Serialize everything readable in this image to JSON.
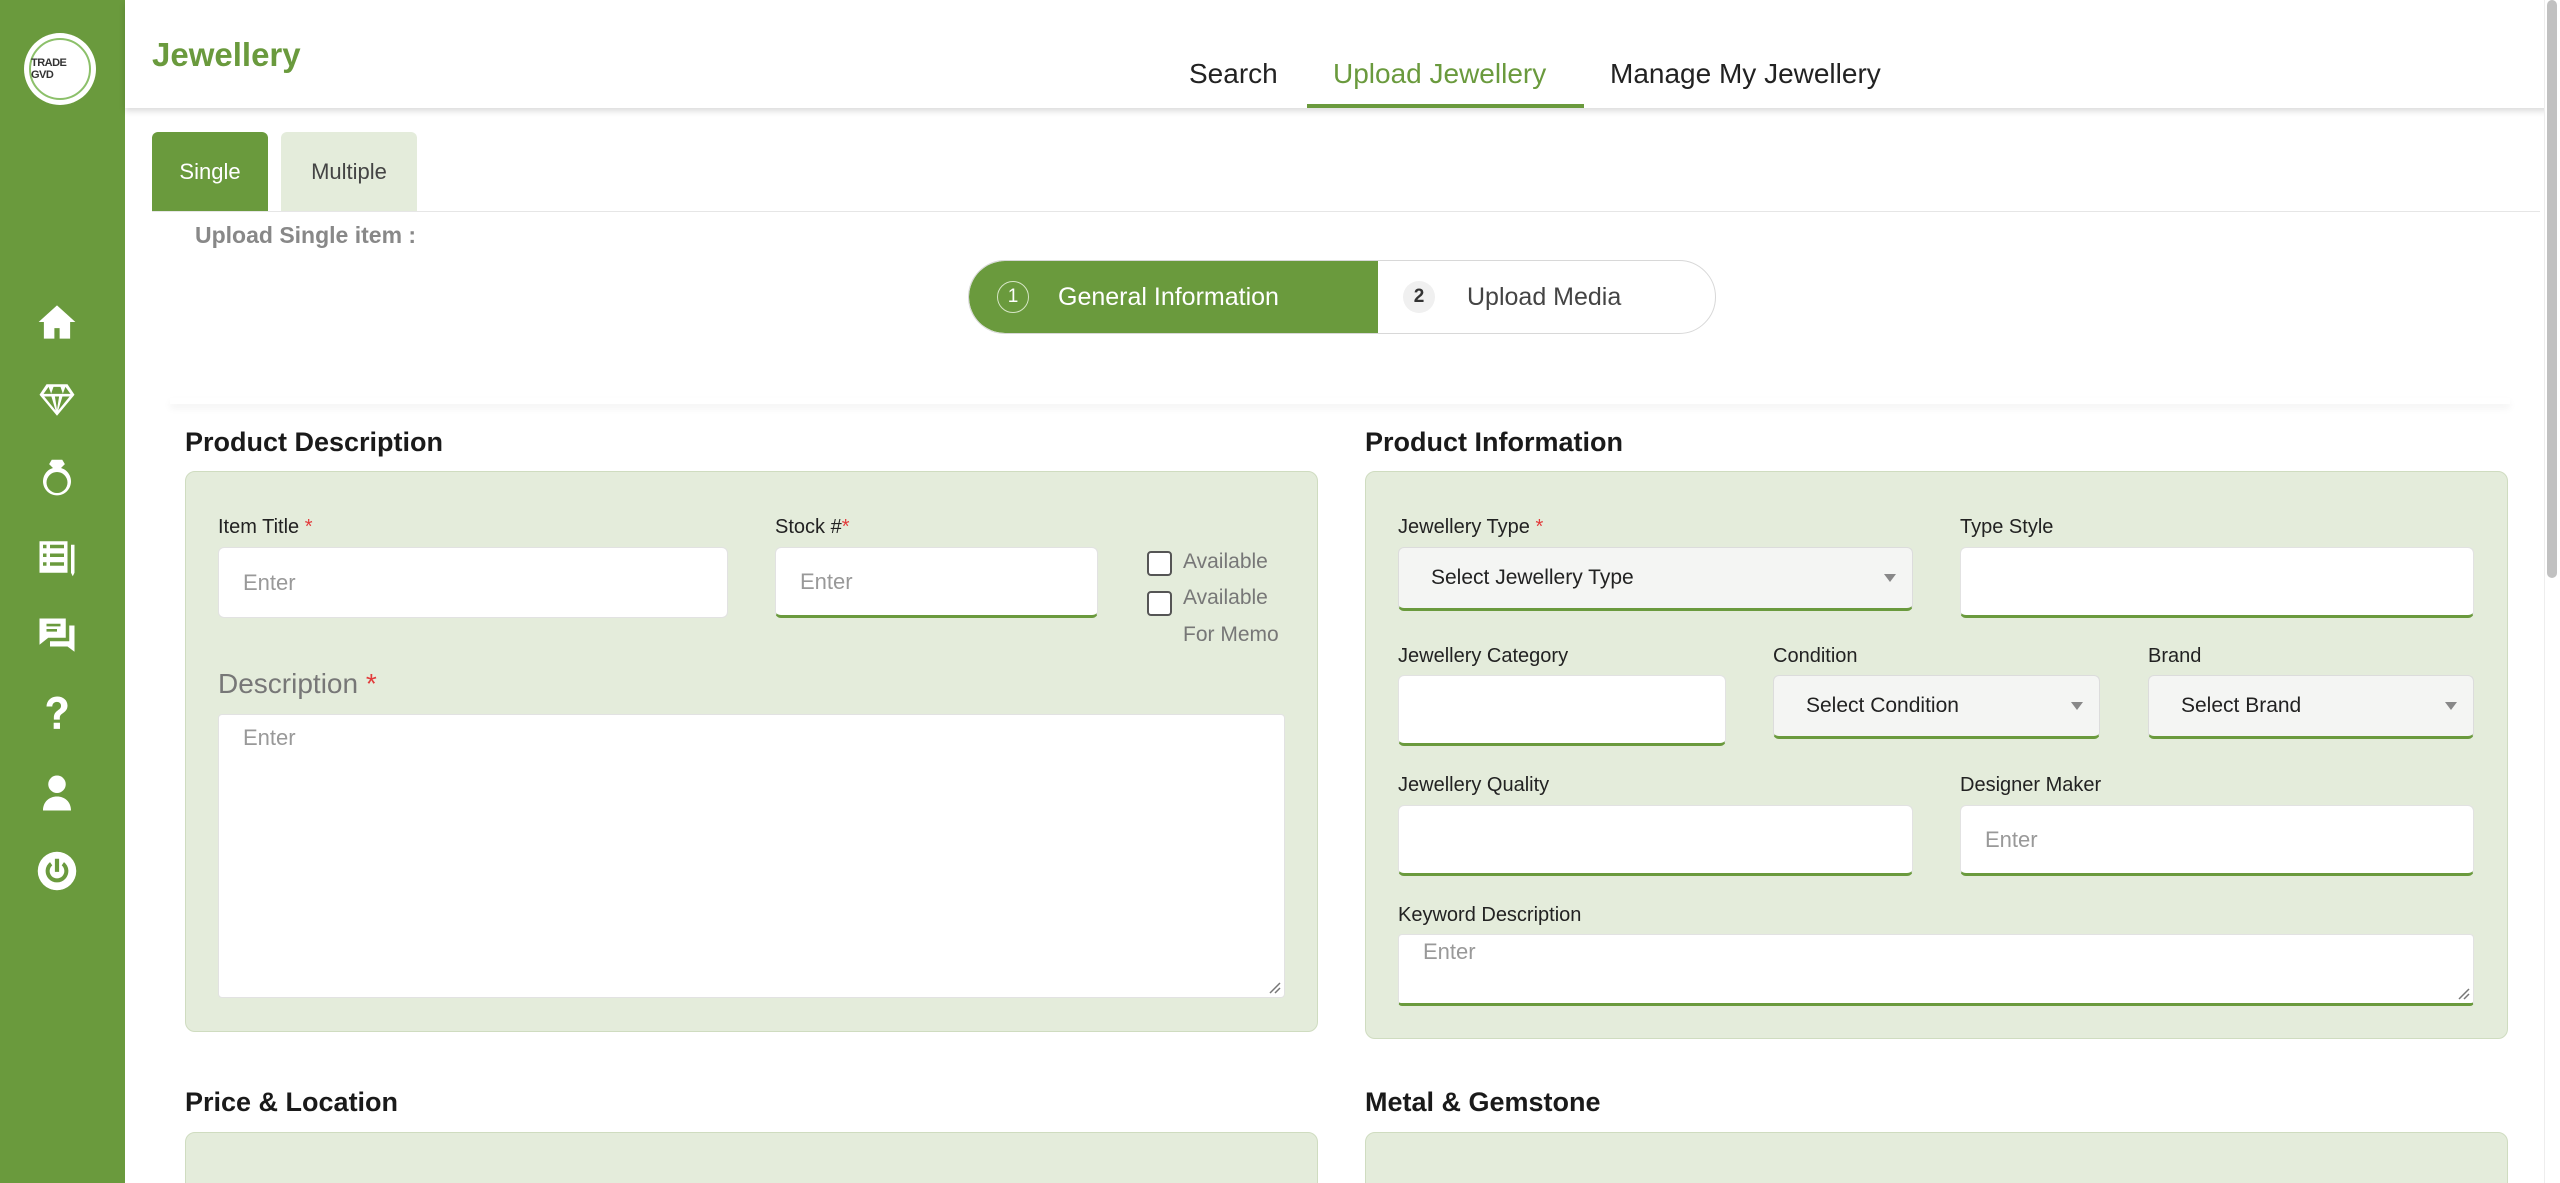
{
  "app": {
    "logo_text": "TRADE GVD",
    "page_title": "Jewellery"
  },
  "sidebar": {
    "items": [
      {
        "icon": "home-icon"
      },
      {
        "icon": "diamond-icon"
      },
      {
        "icon": "ring-icon"
      },
      {
        "icon": "checklist-icon"
      },
      {
        "icon": "chat-icon"
      },
      {
        "icon": "help-icon"
      },
      {
        "icon": "user-icon"
      },
      {
        "icon": "power-icon"
      }
    ]
  },
  "header": {
    "tabs": [
      {
        "label": "Search"
      },
      {
        "label": "Upload Jewellery",
        "active": true
      },
      {
        "label": "Manage My Jewellery"
      }
    ]
  },
  "mode_tabs": {
    "single": "Single",
    "multiple": "Multiple"
  },
  "upload_label": "Upload Single item :",
  "stepper": {
    "steps": [
      {
        "num": "1",
        "label": "General Information"
      },
      {
        "num": "2",
        "label": "Upload Media"
      }
    ]
  },
  "product_description": {
    "title": "Product Description",
    "item_title": {
      "label": "Item Title",
      "required": "*",
      "placeholder": "Enter"
    },
    "stock": {
      "label": "Stock #",
      "required": "*",
      "placeholder": "Enter"
    },
    "available": "Available",
    "available_memo_1": "Available",
    "available_memo_2": "For Memo",
    "description": {
      "label": "Description",
      "required": "*",
      "placeholder": "Enter"
    }
  },
  "product_information": {
    "title": "Product Information",
    "jewellery_type": {
      "label": "Jewellery Type",
      "required": "*",
      "value": "Select Jewellery Type"
    },
    "type_style": {
      "label": "Type Style"
    },
    "jewellery_category": {
      "label": "Jewellery Category"
    },
    "condition": {
      "label": "Condition",
      "value": "Select Condition"
    },
    "brand": {
      "label": "Brand",
      "value": "Select Brand"
    },
    "jewellery_quality": {
      "label": "Jewellery Quality"
    },
    "designer_maker": {
      "label": "Designer Maker",
      "placeholder": "Enter"
    },
    "keyword_description": {
      "label": "Keyword Description",
      "placeholder": "Enter"
    }
  },
  "price_location": {
    "title": "Price & Location"
  },
  "metal_gemstone": {
    "title": "Metal & Gemstone"
  },
  "colors": {
    "accent": "#6a9a3d",
    "panel": "#e4ecdb",
    "required": "#e23b3b"
  }
}
